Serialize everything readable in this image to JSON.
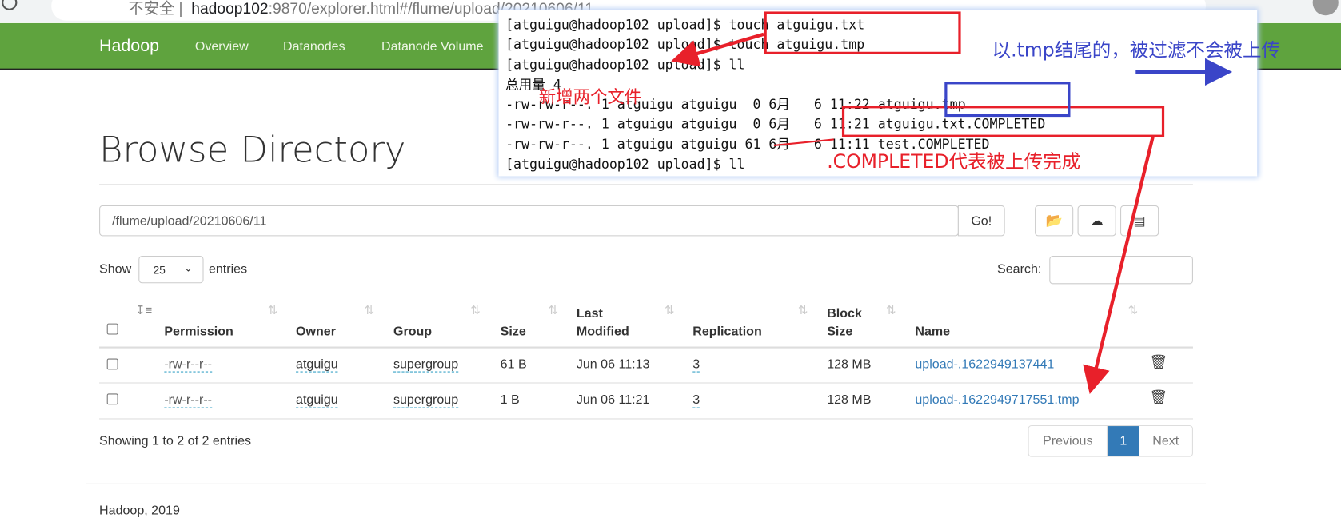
{
  "browser": {
    "security_label": "不安全",
    "url_host": "hadoop102",
    "url_rest": ":9870/explorer.html#/flume/upload/20210606/11"
  },
  "navbar": {
    "brand": "Hadoop",
    "items": [
      "Overview",
      "Datanodes",
      "Datanode Volume"
    ]
  },
  "page": {
    "title": "Browse Directory",
    "path_value": "/flume/upload/20210606/11",
    "go_label": "Go!",
    "show_label": "Show",
    "entries_value": "25",
    "entries_label": "entries",
    "search_label": "Search:",
    "search_value": "",
    "table": {
      "headers": [
        "Permission",
        "Owner",
        "Group",
        "Size",
        "Last",
        "Modified",
        "Replication",
        "Block",
        "Size",
        "Name"
      ],
      "rows": [
        {
          "permission": "-rw-r--r--",
          "owner": "atguigu",
          "group": "supergroup",
          "size": "61 B",
          "modified": "Jun 06 11:13",
          "replication": "3",
          "block_size": "128 MB",
          "name": "upload-.1622949137441"
        },
        {
          "permission": "-rw-r--r--",
          "owner": "atguigu",
          "group": "supergroup",
          "size": "1 B",
          "modified": "Jun 06 11:21",
          "replication": "3",
          "block_size": "128 MB",
          "name": "upload-.1622949717551.tmp"
        }
      ]
    },
    "info": "Showing 1 to 2 of 2 entries",
    "pagination": {
      "previous": "Previous",
      "current": "1",
      "next": "Next"
    },
    "footer": "Hadoop, 2019"
  },
  "terminal": {
    "lines": [
      "[atguigu@hadoop102 upload]$ touch atguigu.txt",
      "[atguigu@hadoop102 upload]$ touch atguigu.tmp",
      "[atguigu@hadoop102 upload]$ ll",
      "总用量 4",
      "-rw-rw-r--. 1 atguigu atguigu  0 6月   6 11:22 atguigu.tmp",
      "-rw-rw-r--. 1 atguigu atguigu  0 6月   6 11:21 atguigu.txt.COMPLETED",
      "-rw-rw-r--. 1 atguigu atguigu 61 6月   6 11:11 test.COMPLETED",
      "[atguigu@hadoop102 upload]$ ll"
    ]
  },
  "annotations": {
    "new_files": "新增两个文件",
    "tmp_note": "以.tmp结尾的，被过滤不会被上传",
    "completed_note": ".COMPLETED代表被上传完成",
    "red": "#e8202a",
    "blue": "#3a45c8"
  },
  "colors": {
    "navbar": "#5fa33e",
    "link": "#337ab7",
    "active_page": "#337ab7"
  }
}
